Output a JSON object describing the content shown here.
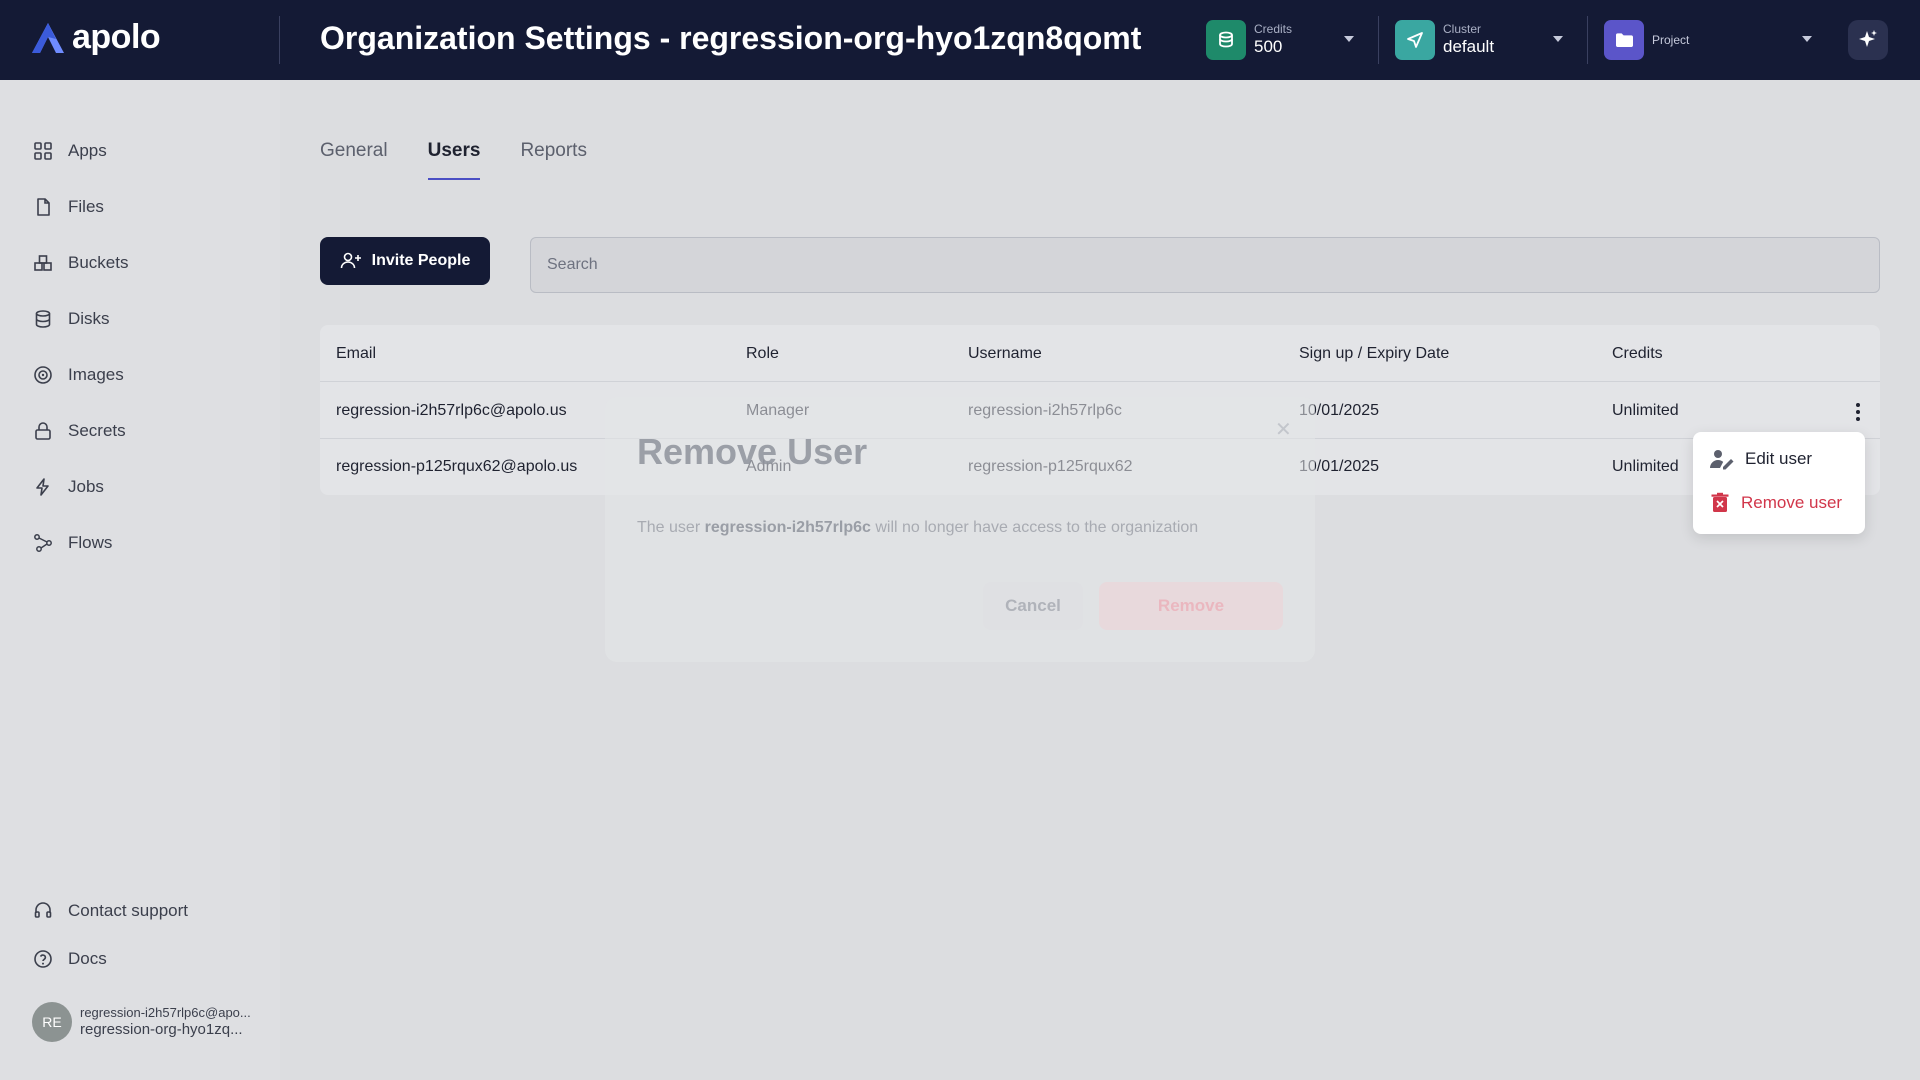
{
  "header": {
    "brand": "apolo",
    "title": "Organization Settings - regression-org-hyo1zqn8qomt",
    "credits": {
      "label": "Credits",
      "value": "500",
      "color": "#1e8a6a"
    },
    "cluster": {
      "label": "Cluster",
      "value": "default",
      "color": "#3aa7a1"
    },
    "project": {
      "label": "Project",
      "color": "#5b55c9"
    }
  },
  "sidebar": {
    "items": [
      {
        "label": "Apps",
        "icon": "apps-grid-icon"
      },
      {
        "label": "Files",
        "icon": "file-icon"
      },
      {
        "label": "Buckets",
        "icon": "buckets-icon"
      },
      {
        "label": "Disks",
        "icon": "database-icon"
      },
      {
        "label": "Images",
        "icon": "images-icon"
      },
      {
        "label": "Secrets",
        "icon": "lock-icon"
      },
      {
        "label": "Jobs",
        "icon": "lightning-icon"
      },
      {
        "label": "Flows",
        "icon": "flows-icon"
      }
    ],
    "footer": [
      {
        "label": "Contact support",
        "icon": "headset-icon"
      },
      {
        "label": "Docs",
        "icon": "help-icon"
      }
    ],
    "user": {
      "initials": "RE",
      "email": "regression-i2h57rlp6c@apo...",
      "org": "regression-org-hyo1zq..."
    }
  },
  "tabs": [
    {
      "label": "General",
      "active": false
    },
    {
      "label": "Users",
      "active": true
    },
    {
      "label": "Reports",
      "active": false
    }
  ],
  "toolbar": {
    "invite_label": "Invite People",
    "search_placeholder": "Search"
  },
  "table": {
    "columns": [
      "Email",
      "Role",
      "Username",
      "Sign up / Expiry Date",
      "Credits"
    ],
    "rows": [
      {
        "email": "regression-i2h57rlp6c@apolo.us",
        "role": "Manager",
        "username": "regression-i2h57rlp6c",
        "date": "10/01/2025",
        "credits": "Unlimited"
      },
      {
        "email": "regression-p125rqux62@apolo.us",
        "role": "Admin",
        "username": "regression-p125rqux62",
        "date": "10/01/2025",
        "credits": "Unlimited"
      }
    ]
  },
  "modal": {
    "title": "Remove User",
    "text_prefix": "The user ",
    "text_user": "regression-i2h57rlp6c",
    "text_suffix": " will no longer have access to the organization",
    "cancel_label": "Cancel",
    "remove_label": "Remove"
  },
  "context_menu": {
    "edit_label": "Edit user",
    "remove_label": "Remove user",
    "remove_color": "#d1364a"
  }
}
